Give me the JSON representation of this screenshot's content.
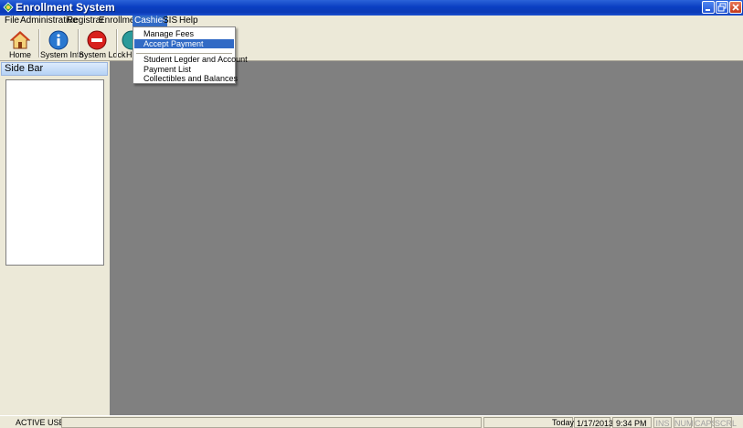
{
  "window": {
    "title": "Enrollment System"
  },
  "menubar": {
    "items": [
      {
        "label": "File"
      },
      {
        "label": "Administrative"
      },
      {
        "label": "Registrar"
      },
      {
        "label": "Enrollment"
      },
      {
        "label": "Cashier"
      },
      {
        "label": "SIS"
      },
      {
        "label": "Help"
      }
    ],
    "active": "Cashier"
  },
  "toolbar": {
    "buttons": [
      {
        "label": "Home",
        "icon": "home-icon"
      },
      {
        "label": "System Info",
        "icon": "info-icon"
      },
      {
        "label": "System Lock",
        "icon": "stop-icon"
      },
      {
        "label": "H",
        "icon": "help-icon"
      }
    ]
  },
  "sidebar": {
    "title": "Side Bar"
  },
  "cashier_menu": {
    "items": [
      {
        "label": "Manage Fees"
      },
      {
        "label": "Accept Payment"
      },
      {
        "label": "Student Legder and Account"
      },
      {
        "label": "Payment List"
      },
      {
        "label": "Collectibles and Balances"
      }
    ],
    "highlighted": "Accept Payment"
  },
  "statusbar": {
    "active_user_label": "ACTIVE USER:",
    "active_user_value": "",
    "today_label": "Today:",
    "date": "1/17/2013",
    "time": "9:34 PM",
    "indicators": [
      "INS",
      "NUM",
      "CAPS",
      "SCRL"
    ]
  },
  "colors": {
    "titlebar": "#0a3fc2",
    "highlight": "#316ac5",
    "mdi_background": "#808080"
  }
}
